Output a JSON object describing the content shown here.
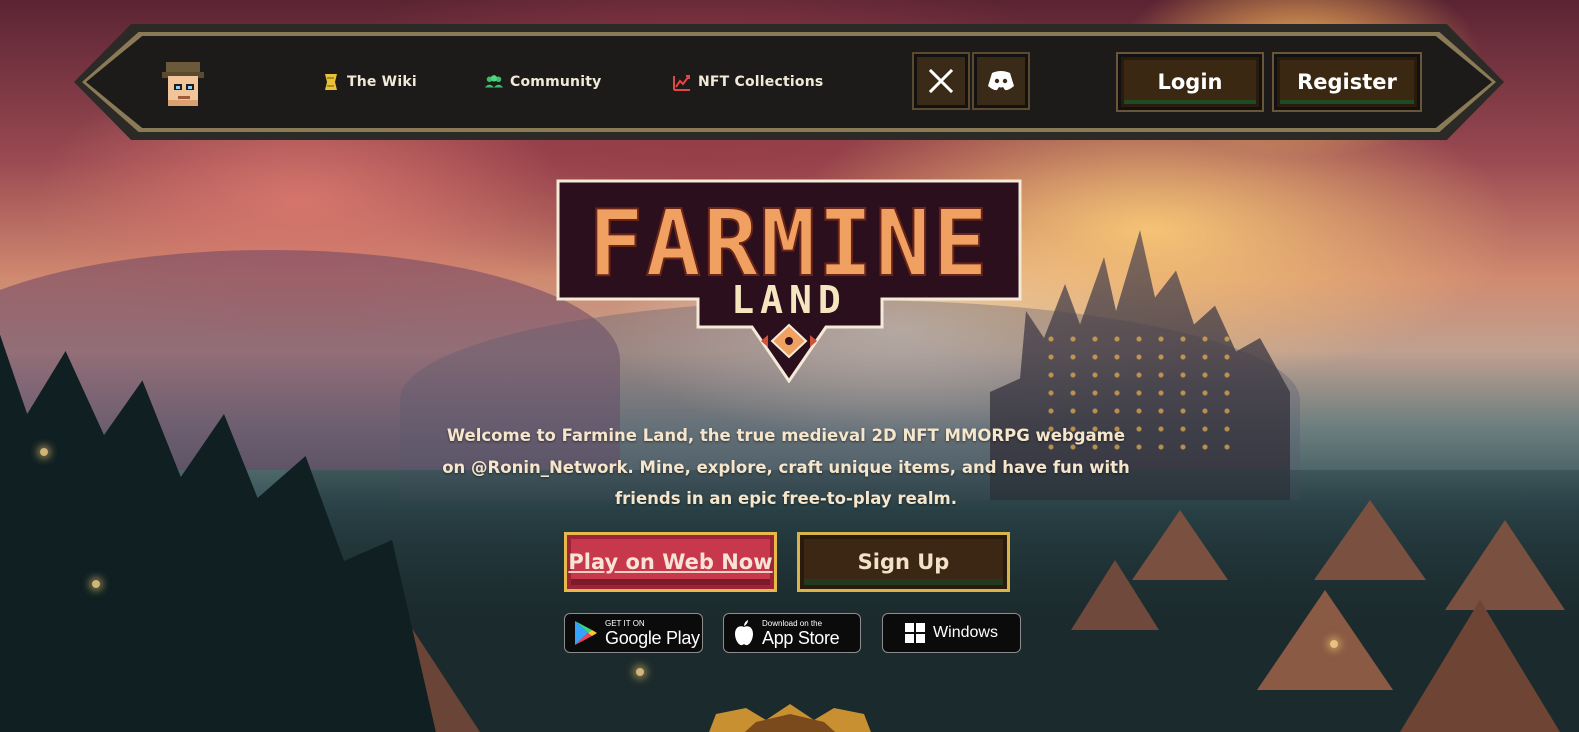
{
  "nav": {
    "links": [
      {
        "label": "The Wiki",
        "icon": "scroll-icon"
      },
      {
        "label": "Community",
        "icon": "people-icon"
      },
      {
        "label": "NFT Collections",
        "icon": "chart-icon"
      }
    ],
    "social": [
      {
        "name": "x-icon"
      },
      {
        "name": "discord-icon"
      }
    ],
    "login_label": "Login",
    "register_label": "Register"
  },
  "logo": {
    "line1": "FARMINE",
    "line2": "LAND"
  },
  "description": "Welcome to Farmine Land, the true medieval 2D NFT MMORPG webgame on @Ronin_Network. Mine, explore, craft unique items, and have fun with friends in an epic free-to-play realm.",
  "cta": {
    "play_label": "Play on Web Now",
    "signup_label": "Sign Up"
  },
  "stores": {
    "google_small": "GET IT ON",
    "google_big": "Google Play",
    "apple_small": "Download on the",
    "apple_big": "App Store",
    "windows": "Windows"
  },
  "colors": {
    "accent_red": "#c8384c",
    "gold_border": "#e7b84a",
    "nav_bg": "#1c1b19",
    "text_cream": "#f5e6cc"
  }
}
